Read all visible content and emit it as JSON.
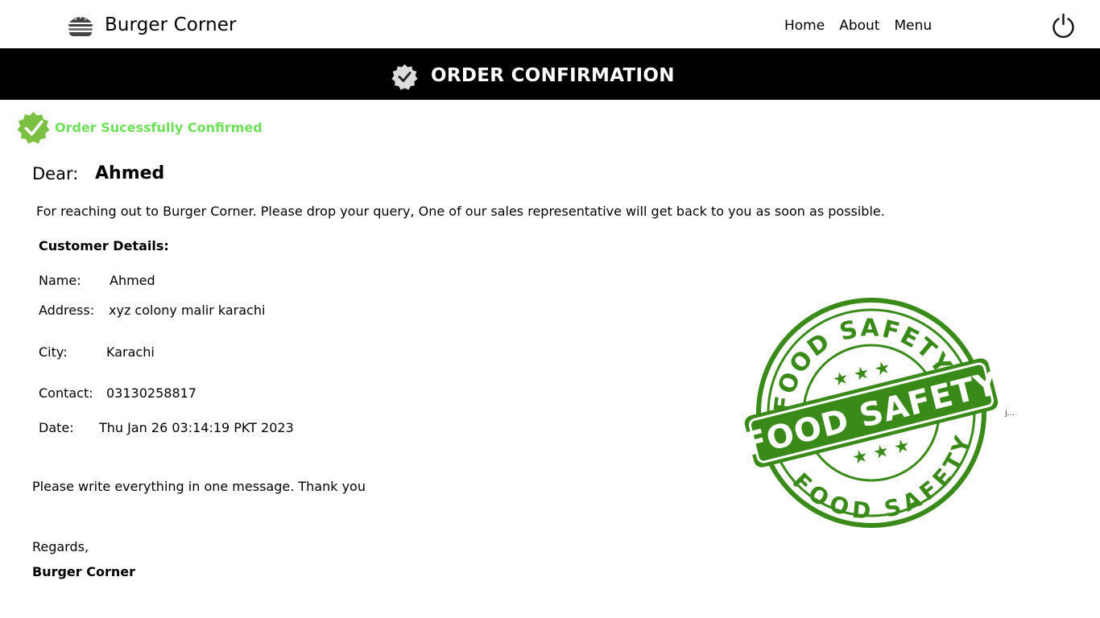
{
  "nav": {
    "brand": "Burger Corner",
    "links": [
      "Home",
      "About",
      "Menu"
    ],
    "power_icon": "power-icon",
    "brand_icon": "burger-icon"
  },
  "banner": {
    "title": "ORDER CONFIRMATION",
    "icon": "verified-badge-icon"
  },
  "status": {
    "text": "Order Sucessfully Confirmed",
    "color": "#6fe05a",
    "icon": "check-badge-icon"
  },
  "greeting": {
    "label": "Dear:",
    "name": "Ahmed"
  },
  "intro": "For reaching out to Burger Corner. Please drop your query, One of our sales representative will get back to you as soon as possible.",
  "customer": {
    "title": "Customer Details:",
    "fields": [
      {
        "label": "Name:",
        "value": "Ahmed"
      },
      {
        "label": "Address:",
        "value": "xyz colony malir karachi"
      },
      {
        "label": "City:",
        "value": "Karachi"
      },
      {
        "label": "Contact:",
        "value": "03130258817"
      },
      {
        "label": "Date:",
        "value": "Thu Jan 26 03:14:19 PKT 2023"
      }
    ]
  },
  "note": "Please write everything in one message. Thank you",
  "closing": {
    "regards": "Regards,",
    "signature": "Burger Corner"
  },
  "stamp": {
    "text_top": "FOOD SAFETY",
    "text_center": "FOOD SAFETY",
    "text_bottom": "FOOD SAFETY",
    "color": "#3a8a1a"
  },
  "broken_image_alt": "j..."
}
